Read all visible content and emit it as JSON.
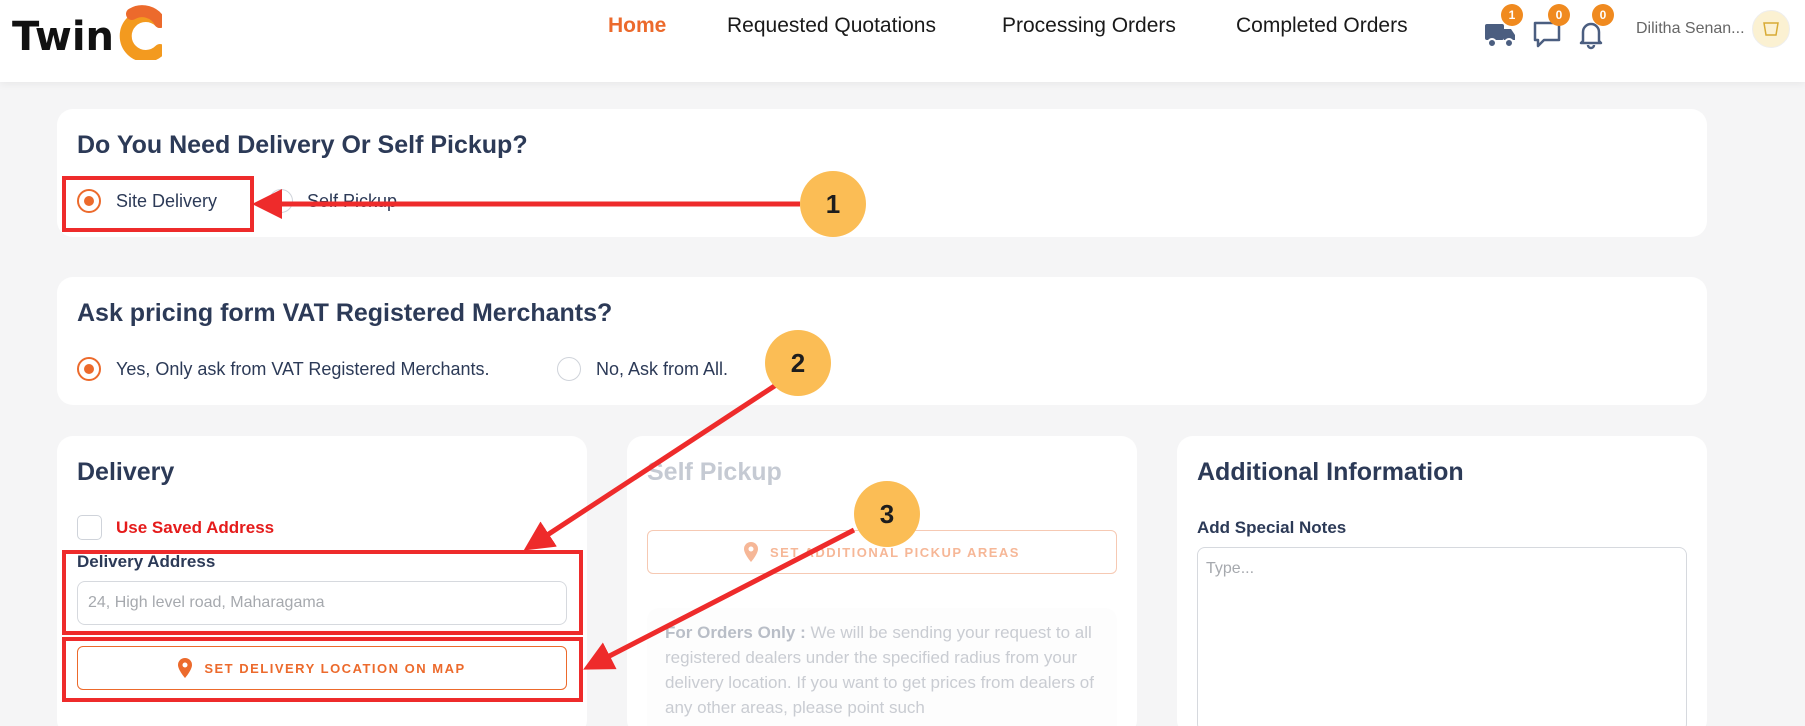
{
  "header": {
    "logo": "TwinC",
    "nav": [
      {
        "label": "Home",
        "active": true
      },
      {
        "label": "Requested Quotations",
        "active": false
      },
      {
        "label": "Processing Orders",
        "active": false
      },
      {
        "label": "Completed Orders",
        "active": false
      }
    ],
    "icons": [
      {
        "name": "truck-icon",
        "badge": "1"
      },
      {
        "name": "chat-icon",
        "badge": "0"
      },
      {
        "name": "bell-icon",
        "badge": "0"
      }
    ],
    "user_name": "Dilitha Senan...",
    "accent_color": "#ec6a2c"
  },
  "delivery_choice": {
    "title": "Do You Need Delivery Or Self Pickup?",
    "options": [
      {
        "label": "Site Delivery",
        "selected": true
      },
      {
        "label": "Self Pickup",
        "selected": false
      }
    ]
  },
  "vat_choice": {
    "title": "Ask pricing form VAT Registered Merchants?",
    "options": [
      {
        "label": "Yes, Only ask from VAT Registered Merchants.",
        "selected": true
      },
      {
        "label": "No, Ask from All.",
        "selected": false
      }
    ]
  },
  "delivery": {
    "title": "Delivery",
    "use_saved_label": "Use Saved Address",
    "address_label": "Delivery Address",
    "address_placeholder": "24, High level road, Maharagama",
    "map_button": "SET DELIVERY LOCATION ON MAP"
  },
  "self_pickup": {
    "title": "Self Pickup",
    "button": "SET ADDITIONAL PICKUP AREAS",
    "info_bold": "For Orders Only :",
    "info_text": " We will be sending your request to all registered dealers under the specified radius from your delivery location. If you want to get prices from dealers of any other areas, please point such"
  },
  "additional": {
    "title": "Additional Information",
    "notes_label": "Add Special Notes",
    "notes_placeholder": "Type..."
  },
  "annotations": {
    "markers": [
      "1",
      "2",
      "3"
    ],
    "highlight_color": "#ee2b2b",
    "marker_color": "#fbbd55"
  }
}
